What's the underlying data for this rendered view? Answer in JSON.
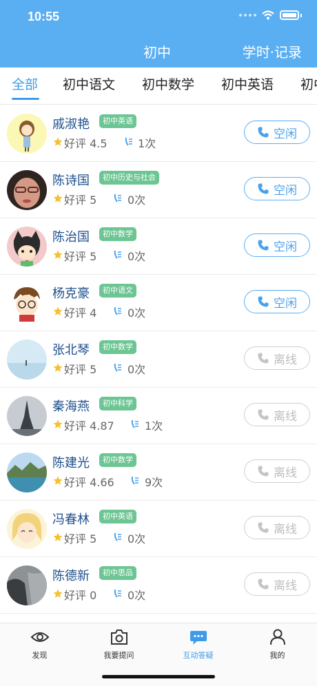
{
  "status_bar": {
    "time": "10:55"
  },
  "nav": {
    "title": "初中",
    "right_label": "学时·记录"
  },
  "tabs": [
    {
      "label": "全部"
    },
    {
      "label": "初中语文"
    },
    {
      "label": "初中数学"
    },
    {
      "label": "初中英语"
    },
    {
      "label": "初中"
    }
  ],
  "teachers": [
    {
      "name": "戚淑艳",
      "subject": "初中英语",
      "rating": "好评 4.5",
      "calls": "1次",
      "status": "空闲"
    },
    {
      "name": "陈诗国",
      "subject": "初中历史与社会",
      "rating": "好评 5",
      "calls": "0次",
      "status": "空闲"
    },
    {
      "name": "陈治国",
      "subject": "初中数学",
      "rating": "好评 5",
      "calls": "0次",
      "status": "空闲"
    },
    {
      "name": "杨克豪",
      "subject": "初中语文",
      "rating": "好评 4",
      "calls": "0次",
      "status": "空闲"
    },
    {
      "name": "张北琴",
      "subject": "初中数学",
      "rating": "好评 5",
      "calls": "0次",
      "status": "离线"
    },
    {
      "name": "秦海燕",
      "subject": "初中科学",
      "rating": "好评 4.87",
      "calls": "1次",
      "status": "离线"
    },
    {
      "name": "陈建光",
      "subject": "初中数学",
      "rating": "好评 4.66",
      "calls": "9次",
      "status": "离线"
    },
    {
      "name": "冯春林",
      "subject": "初中英语",
      "rating": "好评 5",
      "calls": "0次",
      "status": "离线"
    },
    {
      "name": "陈德新",
      "subject": "初中思品",
      "rating": "好评 0",
      "calls": "0次",
      "status": "离线"
    }
  ],
  "tabbar": [
    {
      "label": "发现",
      "icon": "eye-icon"
    },
    {
      "label": "我要提问",
      "icon": "camera-icon"
    },
    {
      "label": "互动答疑",
      "icon": "chat-icon"
    },
    {
      "label": "我的",
      "icon": "person-icon"
    }
  ],
  "colors": {
    "primary": "#5aaef2",
    "accent": "#3d9be9",
    "tag": "#6cc593",
    "name": "#1e4f8c",
    "offline": "#bdbdbd"
  }
}
